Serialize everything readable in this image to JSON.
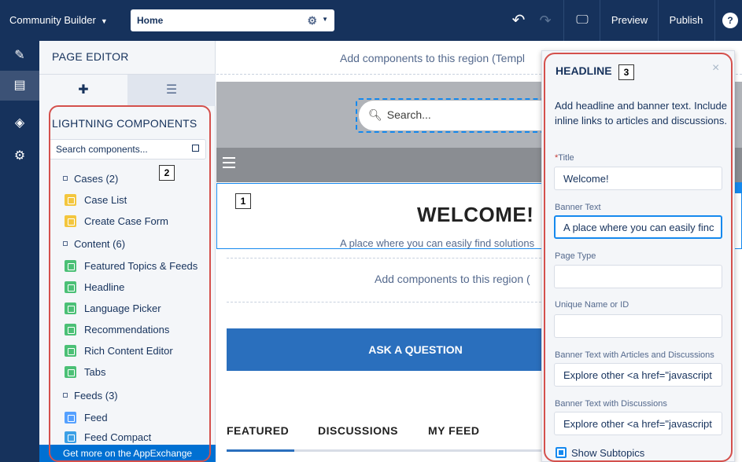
{
  "topbar": {
    "app_name": "Community Builder",
    "page_select": "Home",
    "preview": "Preview",
    "publish": "Publish",
    "help": "?"
  },
  "editor": {
    "header": "PAGE EDITOR",
    "section_title": "LIGHTNING COMPONENTS",
    "search_placeholder": "Search components...",
    "groups": [
      {
        "label": "Cases (2)",
        "items": [
          "Case List",
          "Create Case Form"
        ]
      },
      {
        "label": "Content (6)",
        "items": [
          "Featured Topics & Feeds",
          "Headline",
          "Language Picker",
          "Recommendations",
          "Rich Content Editor",
          "Tabs"
        ]
      },
      {
        "label": "Feeds (3)",
        "items": [
          "Feed",
          "Feed Compact"
        ]
      }
    ],
    "appexchange": "Get more on the AppExchange"
  },
  "callouts": {
    "one": "1",
    "two": "2",
    "three": "3"
  },
  "canvas": {
    "region_top": "Add components to this region (Templ",
    "search_placeholder": "Search...",
    "welcome_title": "WELCOME!",
    "welcome_subtitle": "A place where you can easily find solutions",
    "region_mid": "Add components to this region (",
    "ask_button": "ASK A QUESTION",
    "tabs": [
      "FEATURED",
      "DISCUSSIONS",
      "MY FEED"
    ]
  },
  "panel": {
    "title": "HEADLINE",
    "close": "×",
    "description": "Add headline and banner text. Include inline links to articles and discussions.",
    "fields": {
      "title_label": "Title",
      "title_value": "Welcome!",
      "banner_label": "Banner Text",
      "banner_value": "A place where you can easily finc",
      "page_type_label": "Page Type",
      "unique_label": "Unique Name or ID",
      "articles_label": "Banner Text with Articles and Discussions",
      "articles_value": "Explore other <a href=\"javascript",
      "discussions_label": "Banner Text with Discussions",
      "discussions_value": "Explore other <a href=\"javascript"
    },
    "checkbox_label": "Show Subtopics"
  },
  "icon_colors": {
    "case": "#f3c63e",
    "content": "#4bc076",
    "feed": "#54a0ff",
    "feed_compact": "#3ba0e6"
  }
}
